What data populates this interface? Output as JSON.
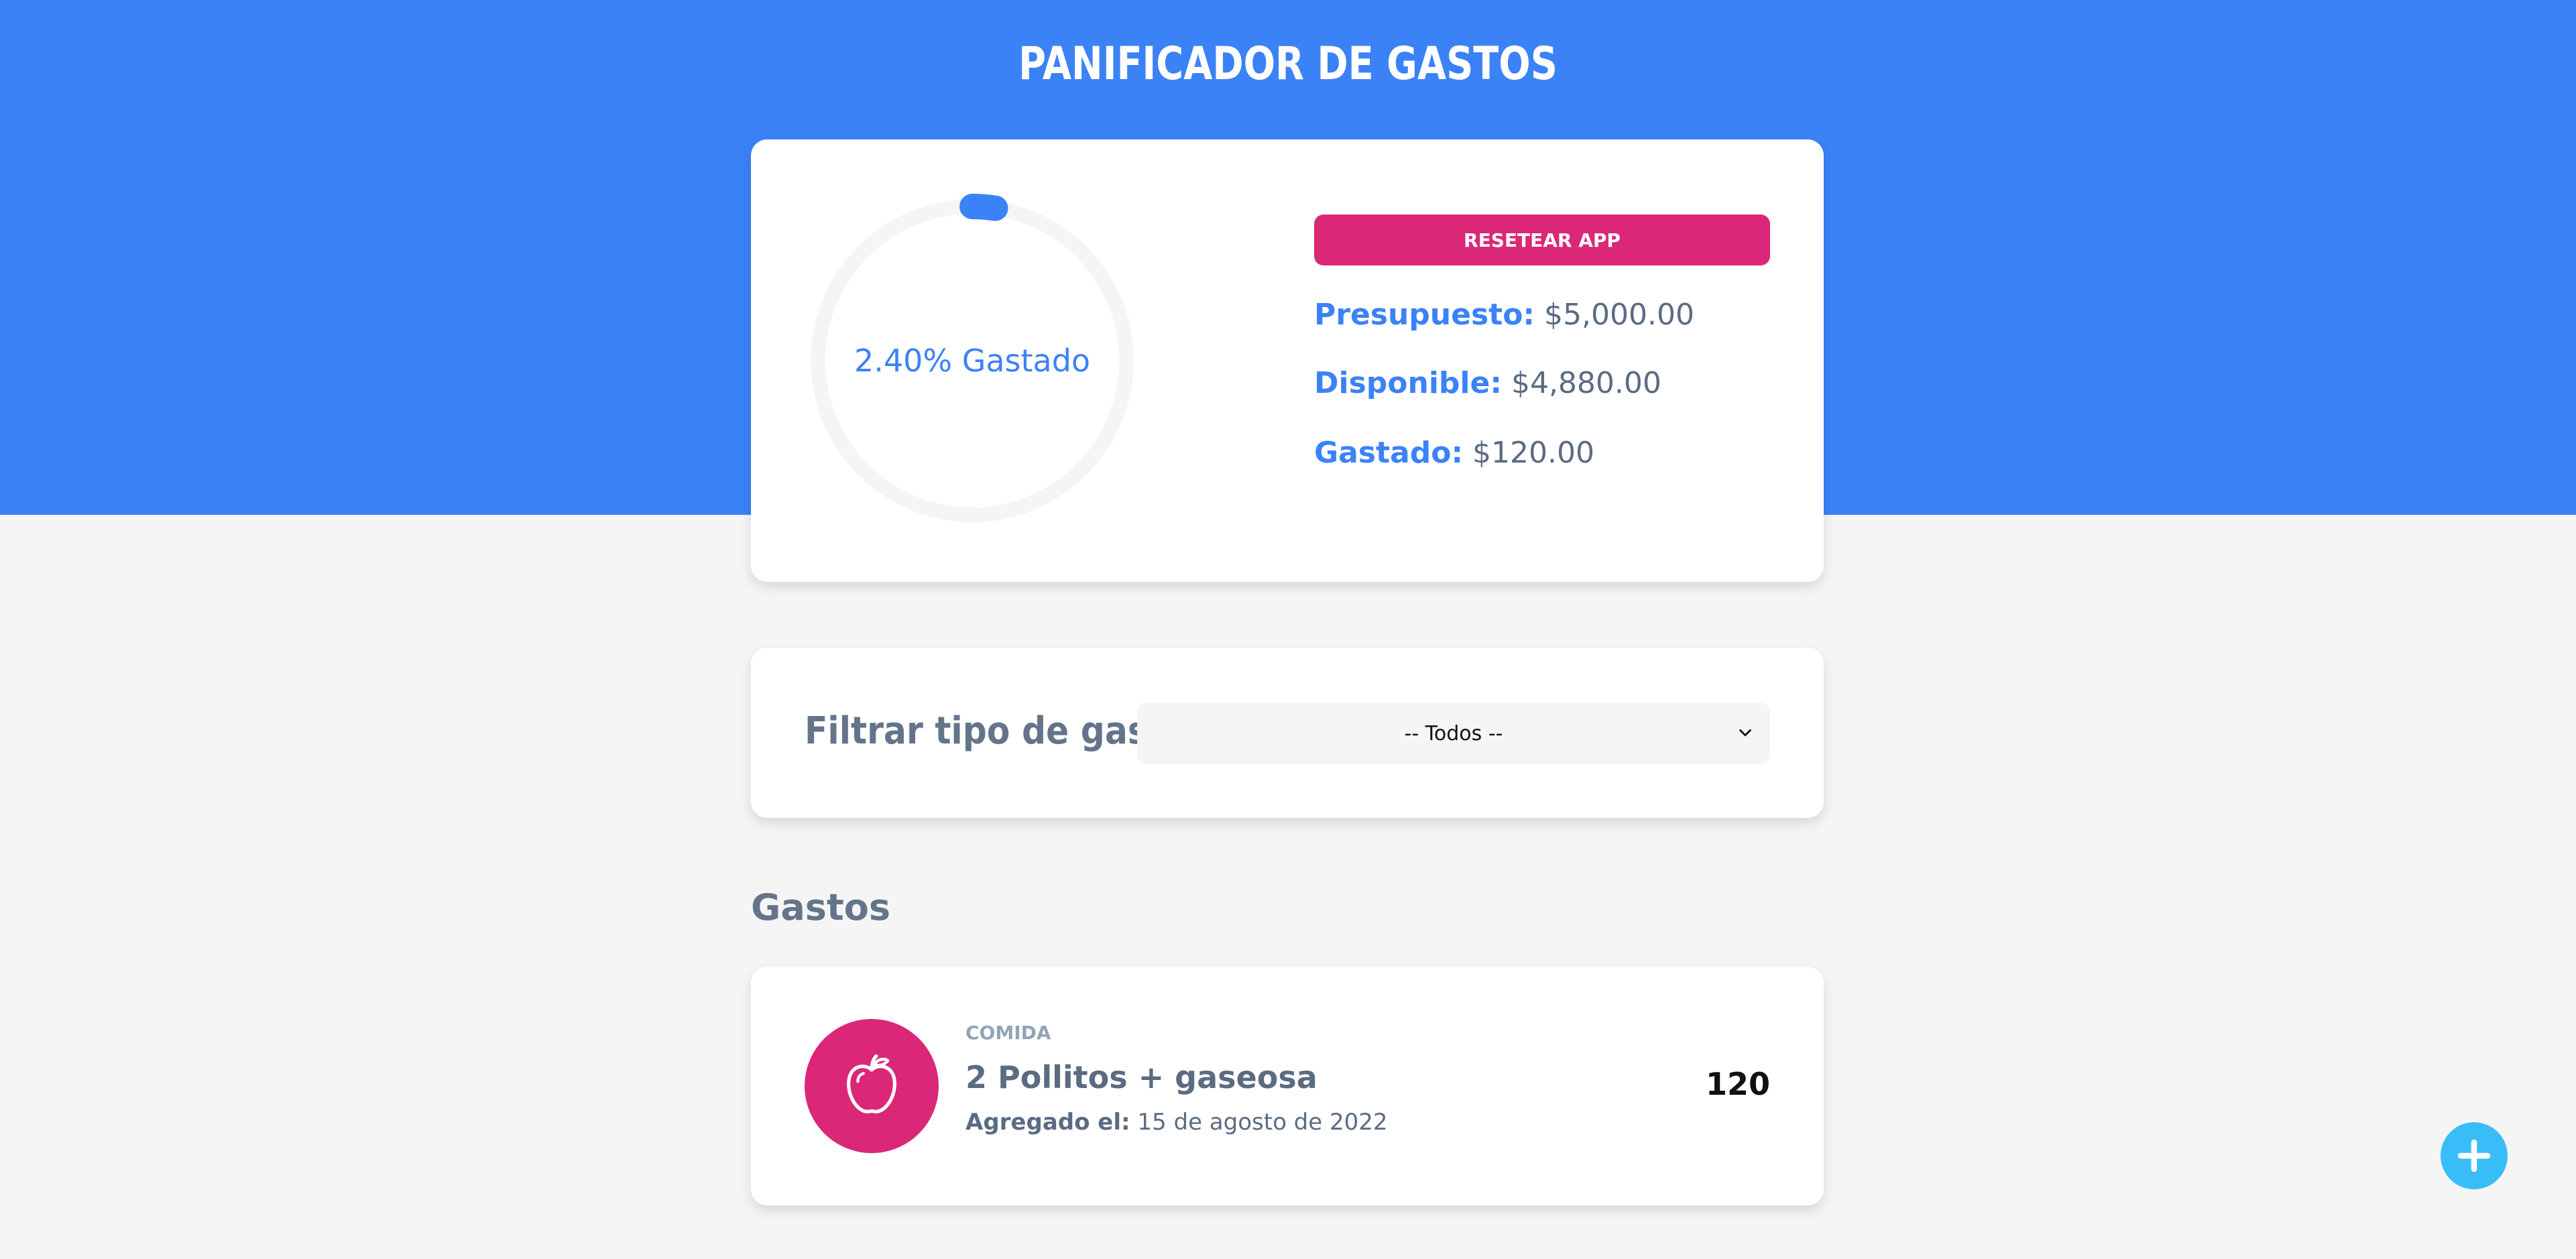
{
  "header": {
    "title": "PANIFICADOR DE GASTOS"
  },
  "budget": {
    "percent_spent": 2.4,
    "progress_label": "2.40% Gastado",
    "reset_label": "RESETEAR APP",
    "presupuesto_label": "Presupuesto:",
    "presupuesto_value": "$5,000.00",
    "disponible_label": "Disponible:",
    "disponible_value": "$4,880.00",
    "gastado_label": "Gastado:",
    "gastado_value": "$120.00"
  },
  "filter": {
    "label": "Filtrar tipo de gastos",
    "selected": "-- Todos --",
    "icon": "chevron-down-icon"
  },
  "expenses_section": {
    "title": "Gastos"
  },
  "expenses": [
    {
      "category": "COMIDA",
      "name": "2 Pollitos + gaseosa",
      "date_label": "Agregado el:",
      "date_value": "15 de agosto de 2022",
      "amount": "120",
      "icon": "apple-icon"
    }
  ],
  "fab": {
    "icon": "plus-icon"
  },
  "colors": {
    "primary": "#3b82f6",
    "accent": "#db2777",
    "fab": "#38bdf8",
    "track": "#f5f5f5",
    "text_muted": "#64748b"
  }
}
